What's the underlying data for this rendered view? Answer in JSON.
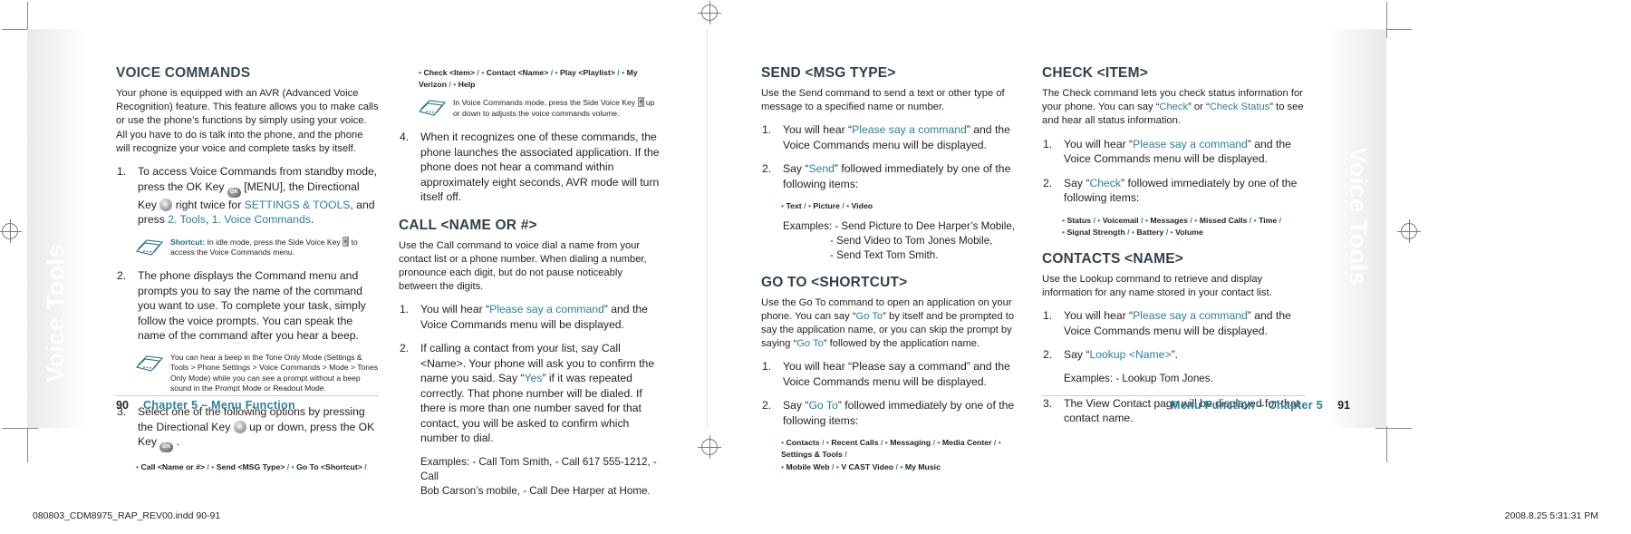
{
  "tab": {
    "label_left": "Voice Tools",
    "label_right": "Voice Tools"
  },
  "accent_color": "#2f7f97",
  "heading_color": "#3a4a55",
  "footer": {
    "left_page_number": "90",
    "left_text": "Chapter 5 – Menu Function",
    "right_text": "Menu Function – Chapter 5",
    "right_page_number": "91",
    "slug_left": "080803_CDM8975_RAP_REV00.indd   90-91",
    "slug_right": "2008.8.25   5:31:31 PM"
  },
  "col1": {
    "heading": "VOICE COMMANDS",
    "intro": "Your phone is equipped with an AVR (Advanced Voice Recognition) feature. This feature allows you to make calls or use the phone’s functions by simply using your voice. All you have to do is talk into the phone, and the phone will recognize your voice and complete tasks by itself.",
    "step1_a": "To access Voice Commands from standby mode, press the OK Key",
    "step1_b": "[MENU], the Directional Key",
    "step1_c": "right twice for",
    "step1_link1": "SETTINGS & TOOLS",
    "step1_d": ", and press",
    "step1_link2": "2. Tools",
    "step1_link3": "1. Voice Commands",
    "step1_e": ".",
    "note1_label": "Shortcut:",
    "note1_a": "In idle mode, press the Side Voice Key",
    "note1_b": "to access the Voice Commands menu.",
    "step2": "The phone displays the Command menu and prompts you to say the name of the command you want to use. To complete your task, simply follow the voice prompts. You can speak the name of the command after you hear a beep.",
    "note2": "You can hear a beep in the Tone Only Mode (Settings & Tools > Phone Settings > Voice Commands > Mode > Tones Only Mode) while you can see a prompt without a beep sound in the Prompt Mode or Readout Mode.",
    "step3_a": "Select one of the following options by pressing the Directional Key",
    "step3_b": "up or down, press the OK Key",
    "step3_c": ".",
    "options_row1": [
      "Call <Name or #>",
      "Send <MSG Type>",
      "Go To  <Shortcut>"
    ]
  },
  "col2": {
    "options_row2": [
      "Check <Item>",
      "Contact <Name>",
      "Play <Playlist>",
      "My Verizon",
      "Help"
    ],
    "note3_a": "In Voice Commands mode, press the Side Voice Key",
    "note3_b": "up or down to adjusts the voice commands volume.",
    "step4": "When it recognizes one of these commands, the phone launches the associated application. If the phone does not hear a command within approximately eight seconds, AVR mode will turn itself off.",
    "heading": "CALL <NAME OR #>",
    "intro": "Use the Call command to voice dial a name from your contact list or a phone number. When dialing a number, pronounce each digit, but do not pause noticeably between the digits.",
    "step1_a": "You will hear “",
    "step1_link": "Please say a command",
    "step1_b": "” and the Voice Commands menu will be displayed.",
    "step2_a": "If calling a contact from your list, say Call <Name>. Your phone will ask you to confirm the name you said. Say “",
    "step2_link": "Yes",
    "step2_b": "” if it was repeated correctly. That phone number will be dialed. If there is more than one number saved for that contact, you will be asked to confirm which number to dial.",
    "examples_label": "Examples: - Call Tom Smith, - Call 617 555-1212, - Call",
    "examples_line2": "Bob Carson’s mobile, - Call Dee Harper at Home."
  },
  "col3": {
    "heading1": "SEND <MSG TYPE>",
    "intro1": "Use the Send command to send a text or other type of message to a specified name or number.",
    "s1_step1_a": "You will hear “",
    "s1_step1_link": "Please say a command",
    "s1_step1_b": "” and the Voice Commands menu will be displayed.",
    "s1_step2_a": "Say “",
    "s1_step2_link": "Send",
    "s1_step2_b": "” followed immediately by one of the following items:",
    "s1_bullets": [
      "Text",
      "Picture",
      "Video"
    ],
    "s1_examples_label": "Examples: - Send Picture to Dee Harper’s Mobile,",
    "s1_examples_l2": "- Send Video to Tom Jones Mobile,",
    "s1_examples_l3": "- Send Text Tom Smith.",
    "heading2": "GO TO <SHORTCUT>",
    "intro2_a": "Use the Go To command to open an application on your phone. You can say “",
    "intro2_link1": "Go To",
    "intro2_b": "” by itself and be prompted to say the application name, or you can skip the prompt by saying “",
    "intro2_link2": "Go To",
    "intro2_c": "” followed by the application name.",
    "s2_step1": "You will hear “Please say a command” and the Voice Commands menu will be displayed.",
    "s2_step2_a": "Say “",
    "s2_step2_link": "Go To",
    "s2_step2_b": "” followed immediately by one of the following items:",
    "s2_bullets_row1": [
      "Contacts",
      "Recent Calls",
      "Messaging",
      "Media Center",
      "Settings & Tools"
    ],
    "s2_bullets_row2": [
      "Mobile Web",
      "V CAST Video",
      "My Music"
    ]
  },
  "col4": {
    "heading1": "CHECK <ITEM>",
    "intro1_a": "The Check command lets you check status information for your phone. You can say “",
    "intro1_link1": "Check",
    "intro1_b": "” or “",
    "intro1_link2": "Check Status",
    "intro1_c": "” to see and hear all status information.",
    "s1_step1_a": "You will hear “",
    "s1_step1_link": "Please say a command",
    "s1_step1_b": "” and the Voice Commands menu will be displayed.",
    "s1_step2_a": "Say “",
    "s1_step2_link": "Check",
    "s1_step2_b": "” followed immediately by one of the following items:",
    "s1_bullets_row1": [
      "Status",
      "Voicemail",
      "Messages",
      "Missed Calls",
      "Time"
    ],
    "s1_bullets_row2": [
      "Signal Strength",
      "Battery",
      "Volume"
    ],
    "heading2": "CONTACTS <NAME>",
    "intro2": "Use the Lookup command to retrieve and display information for any name stored in your contact list.",
    "s2_step1_a": "You will hear “",
    "s2_step1_link": "Please say a command",
    "s2_step1_b": "” and the Voice Commands menu will be displayed.",
    "s2_step2_a": "Say “",
    "s2_step2_link": "Lookup <Name>",
    "s2_step2_b": "”.",
    "s2_examples": "Examples: - Lookup Tom Jones.",
    "s2_step3": "The View Contact page will be displayed for that contact name."
  },
  "icons": {
    "ok_key": "ok-key-icon",
    "nav_key": "directional-key-icon",
    "side_key": "side-voice-key-icon",
    "note": "note-cards-icon",
    "registration": "registration-mark-icon"
  }
}
